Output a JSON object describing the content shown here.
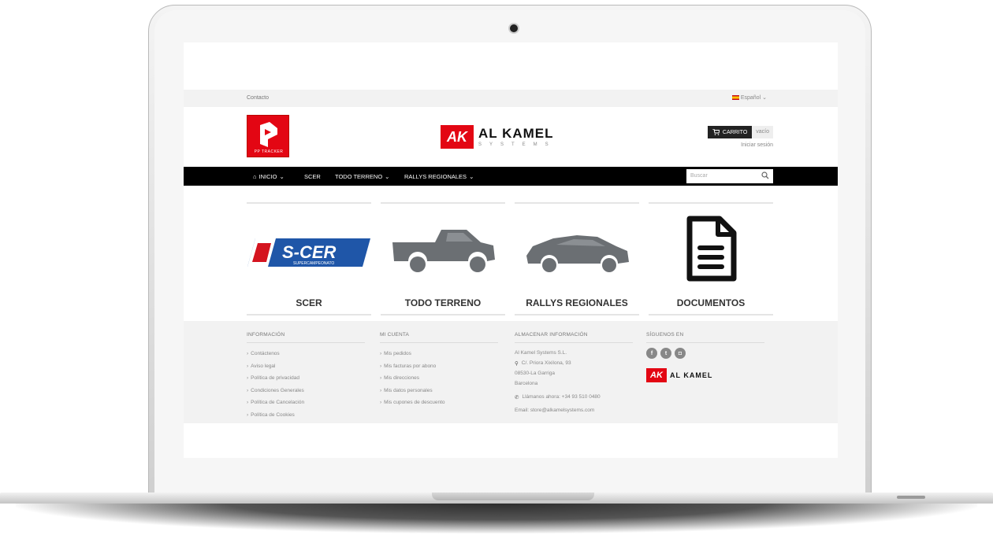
{
  "topbar": {
    "contact": "Contacto",
    "language": "Español"
  },
  "logos": {
    "pp_tracker": "PP TRACKER",
    "brand_name": "AL KAMEL",
    "brand_sub": "SYSTEMS",
    "brand_mark": "AK"
  },
  "header": {
    "cart_label": "CARRITO",
    "cart_status": "vacío",
    "signin": "Iniciar sesión"
  },
  "nav": {
    "items": [
      {
        "label": "INICIO",
        "icon": "home-icon",
        "dropdown": true
      },
      {
        "label": "SCER",
        "dropdown": false
      },
      {
        "label": "TODO TERRENO",
        "dropdown": true
      },
      {
        "label": "RALLYS REGIONALES",
        "dropdown": true
      }
    ],
    "search_placeholder": "Buscar"
  },
  "tiles": [
    {
      "label": "SCER",
      "badge": "S-CER",
      "badge_sub": "SUPERCAMPEONATO"
    },
    {
      "label": "TODO TERRENO"
    },
    {
      "label": "RALLYS REGIONALES"
    },
    {
      "label": "DOCUMENTOS"
    }
  ],
  "footer": {
    "info": {
      "heading": "INFORMACIÓN",
      "links": [
        "Contáctenos",
        "Aviso legal",
        "Política de privacidad",
        "Condiciones Generales",
        "Política de Cancelación",
        "Política de Cookies"
      ]
    },
    "account": {
      "heading": "MI CUENTA",
      "links": [
        "Mis pedidos",
        "Mis facturas por abono",
        "Mis direcciones",
        "Mis datos personales",
        "Mis cupones de descuento"
      ]
    },
    "store": {
      "heading": "ALMACENAR INFORMACIÓN",
      "company": "Al Kamel Systems S.L.",
      "address1": "C/. Priora Xixilona, 93",
      "address2": "08530-La Garriga",
      "address3": "Barcelona",
      "phone": "Llámanos ahora: +34 93 510 0480",
      "email": "Email: store@alkamelsystems.com"
    },
    "social": {
      "heading": "SÍGUENOS EN",
      "icons": [
        "facebook-icon",
        "twitter-icon",
        "instagram-icon"
      ],
      "icon_glyphs": [
        "f",
        "t",
        "◘"
      ]
    }
  },
  "colors": {
    "brand_red": "#e30613",
    "nav_bg": "#000000",
    "footer_bg": "#f2f2f2"
  }
}
